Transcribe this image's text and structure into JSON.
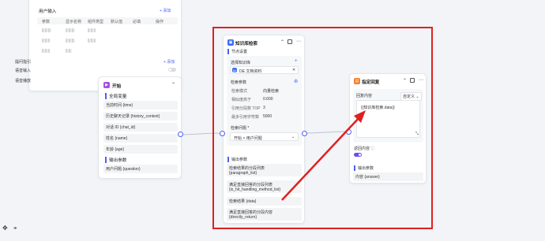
{
  "input_card": {
    "section_title": "用户输入",
    "add_label": "+ 添加",
    "columns": [
      "参数",
      "显示名称",
      "组件类型",
      "默认值",
      "必填",
      "操作"
    ],
    "prompt_label": "提问指引",
    "prompt_add": "+ 添加",
    "voice_input_label": "语音输入",
    "voice_play_label": "语音播放"
  },
  "start_node": {
    "title": "开始",
    "section_global": "全局变量",
    "globals": [
      "当前时间 {time}",
      "历史聊天记录 {history_context}",
      "对话 ID {chat_id}",
      "姓名 {name}",
      "年龄 {age}"
    ],
    "section_output": "输出参数",
    "outputs": [
      "用户问题 {question}"
    ]
  },
  "kb_node": {
    "title": "知识库检索",
    "section_settings": "节点设置",
    "select_kb_label": "选择知识库",
    "kb_name": "DE 文档资料",
    "search_params_label": "检索参数",
    "params": [
      {
        "key": "检索模式",
        "value": "向量检索"
      },
      {
        "key": "相似度高于",
        "value": "0.600"
      },
      {
        "key": "引用分段数 TOP",
        "value": "3"
      },
      {
        "key": "最多引用字符数",
        "value": "5000"
      }
    ],
    "question_label": "检索问题 *",
    "question_value": "开始 > 用户问题",
    "section_output": "输出参数",
    "outputs": [
      [
        "检索结果的分段列表",
        "{paragraph_list}"
      ],
      [
        "满足直接回答的分段列表",
        "{is_hit_handling_method_list}"
      ],
      [
        "检索结果 {data}"
      ],
      [
        "满足直接回答的分段内容",
        "{directly_return}"
      ]
    ]
  },
  "reply_node": {
    "title": "指定回复",
    "content_label": "回复内容",
    "content_mode": "自定义",
    "content_value": "{{知识库检索.data}}",
    "return_label": "返回内容",
    "section_output": "输出参数",
    "outputs": [
      "内容 {answer}"
    ]
  },
  "colors": {
    "kb_accent": "#3b6cf6",
    "start_accent": "#a94de0",
    "reply_accent": "#f57e2a",
    "annotation_red": "#e02020",
    "toggle_on": "#6d4cf6"
  }
}
